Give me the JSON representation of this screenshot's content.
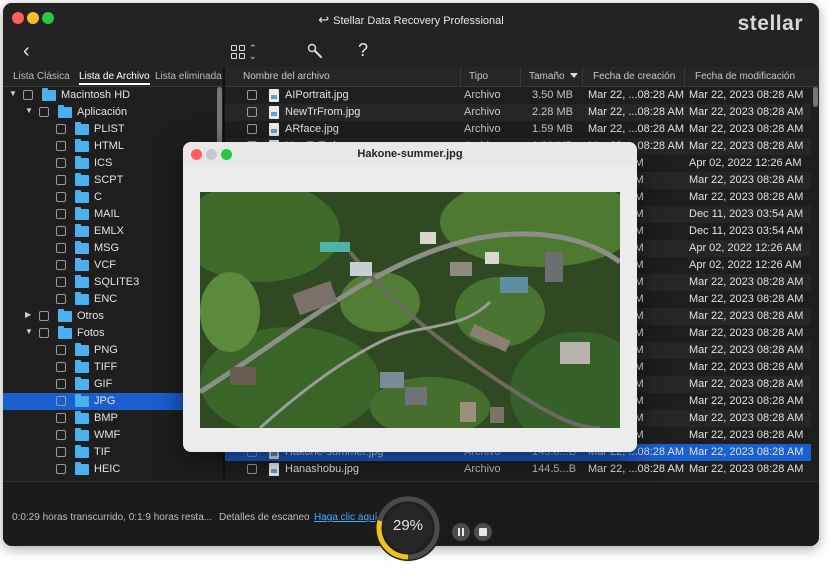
{
  "app": {
    "title": "Stellar Data Recovery Professional",
    "brand": "stellar"
  },
  "left_tabs": [
    {
      "label": "Lista Clásica",
      "active": false
    },
    {
      "label": "Lista de Archivo",
      "active": true
    },
    {
      "label": "Lista eliminada",
      "active": false
    }
  ],
  "tree": [
    {
      "label": "Macintosh HD",
      "level": 0,
      "expanded": true,
      "selected": false
    },
    {
      "label": "Aplicación",
      "level": 1,
      "expanded": true,
      "selected": false
    },
    {
      "label": "PLIST",
      "level": 2,
      "selected": false
    },
    {
      "label": "HTML",
      "level": 2,
      "selected": false
    },
    {
      "label": "ICS",
      "level": 2,
      "selected": false
    },
    {
      "label": "SCPT",
      "level": 2,
      "selected": false
    },
    {
      "label": "C",
      "level": 2,
      "selected": false
    },
    {
      "label": "MAIL",
      "level": 2,
      "selected": false
    },
    {
      "label": "EMLX",
      "level": 2,
      "selected": false
    },
    {
      "label": "MSG",
      "level": 2,
      "selected": false
    },
    {
      "label": "VCF",
      "level": 2,
      "selected": false
    },
    {
      "label": "SQLITE3",
      "level": 2,
      "selected": false
    },
    {
      "label": "ENC",
      "level": 2,
      "selected": false
    },
    {
      "label": "Otros",
      "level": 1,
      "expanded": false,
      "selected": false
    },
    {
      "label": "Fotos",
      "level": 1,
      "expanded": true,
      "selected": false
    },
    {
      "label": "PNG",
      "level": 2,
      "selected": false
    },
    {
      "label": "TIFF",
      "level": 2,
      "selected": false
    },
    {
      "label": "GIF",
      "level": 2,
      "selected": false
    },
    {
      "label": "JPG",
      "level": 2,
      "selected": true
    },
    {
      "label": "BMP",
      "level": 2,
      "selected": false
    },
    {
      "label": "WMF",
      "level": 2,
      "selected": false
    },
    {
      "label": "TIF",
      "level": 2,
      "selected": false
    },
    {
      "label": "HEIC",
      "level": 2,
      "selected": false
    }
  ],
  "columns": [
    "Nombre del archivo",
    "Tipo",
    "Tamaño",
    "Fecha de creación",
    "Fecha de modificación"
  ],
  "rows": [
    {
      "name": "AIPortrait.jpg",
      "type": "Archivo",
      "size": "3.50 MB",
      "created": "Mar 22, ...08:28 AM",
      "modified": "Mar 22, 2023 08:28 AM"
    },
    {
      "name": "NewTrFrom.jpg",
      "type": "Archivo",
      "size": "2.28 MB",
      "created": "Mar 22, ...08:28 AM",
      "modified": "Mar 22, 2023 08:28 AM"
    },
    {
      "name": "ARface.jpg",
      "type": "Archivo",
      "size": "1.59 MB",
      "created": "Mar 22, ...08:28 AM",
      "modified": "Mar 22, 2023 08:28 AM"
    },
    {
      "name": "NewToTo.jpg",
      "type": "Archivo",
      "size": "1.20 MB",
      "created": "Mar 22, ...08:28 AM",
      "modified": "Mar 22, 2023 08:28 AM"
    },
    {
      "name": "",
      "type": "",
      "size": "",
      "created": "...12:26 AM",
      "modified": "Apr 02, 2022 12:26 AM"
    },
    {
      "name": "",
      "type": "",
      "size": "",
      "created": "...08:28 AM",
      "modified": "Mar 22, 2023 08:28 AM"
    },
    {
      "name": "",
      "type": "",
      "size": "",
      "created": "...08:28 AM",
      "modified": "Mar 22, 2023 08:28 AM"
    },
    {
      "name": "",
      "type": "",
      "size": "",
      "created": "...03:54 AM",
      "modified": "Dec 11, 2023 03:54 AM"
    },
    {
      "name": "",
      "type": "",
      "size": "",
      "created": "...03:54 AM",
      "modified": "Dec 11, 2023 03:54 AM"
    },
    {
      "name": "",
      "type": "",
      "size": "",
      "created": "...12:26 AM",
      "modified": "Apr 02, 2022 12:26 AM"
    },
    {
      "name": "",
      "type": "",
      "size": "",
      "created": "...12:26 AM",
      "modified": "Apr 02, 2022 12:26 AM"
    },
    {
      "name": "",
      "type": "",
      "size": "",
      "created": "...08:28 AM",
      "modified": "Mar 22, 2023 08:28 AM"
    },
    {
      "name": "",
      "type": "",
      "size": "",
      "created": "...08:28 AM",
      "modified": "Mar 22, 2023 08:28 AM"
    },
    {
      "name": "",
      "type": "",
      "size": "",
      "created": "...08:28 AM",
      "modified": "Mar 22, 2023 08:28 AM"
    },
    {
      "name": "",
      "type": "",
      "size": "",
      "created": "...08:28 AM",
      "modified": "Mar 22, 2023 08:28 AM"
    },
    {
      "name": "",
      "type": "",
      "size": "",
      "created": "...08:28 AM",
      "modified": "Mar 22, 2023 08:28 AM"
    },
    {
      "name": "",
      "type": "",
      "size": "",
      "created": "...08:28 AM",
      "modified": "Mar 22, 2023 08:28 AM"
    },
    {
      "name": "",
      "type": "",
      "size": "",
      "created": "...08:28 AM",
      "modified": "Mar 22, 2023 08:28 AM"
    },
    {
      "name": "",
      "type": "",
      "size": "",
      "created": "...08:28 AM",
      "modified": "Mar 22, 2023 08:28 AM"
    },
    {
      "name": "",
      "type": "",
      "size": "",
      "created": "...08:28 AM",
      "modified": "Mar 22, 2023 08:28 AM"
    },
    {
      "name": "",
      "type": "",
      "size": "",
      "created": "...08:28 AM",
      "modified": "Mar 22, 2023 08:28 AM"
    },
    {
      "name": "Hakone-summer.jpg",
      "type": "Archivo",
      "size": "145.0...B",
      "created": "Mar 22, ...08:28 AM",
      "modified": "Mar 22, 2023 08:28 AM",
      "selected": true
    },
    {
      "name": "Hanashobu.jpg",
      "type": "Archivo",
      "size": "144.5...B",
      "created": "Mar 22, ...08:28 AM",
      "modified": "Mar 22, 2023 08:28 AM"
    }
  ],
  "footer": {
    "elapsed": "0:0:29 horas transcurrido, 0:1:9 horas resta...",
    "scan_details": "Detalles de escaneo",
    "scan_link": "Haga clic aquí",
    "progress_percent": 29,
    "progress_label": "29%"
  },
  "preview": {
    "title": "Hakone-summer.jpg"
  },
  "colors": {
    "selection": "#1a5fd0",
    "folder": "#4ab0f0",
    "progress": "#f2c21b",
    "link": "#4aa8ff"
  }
}
